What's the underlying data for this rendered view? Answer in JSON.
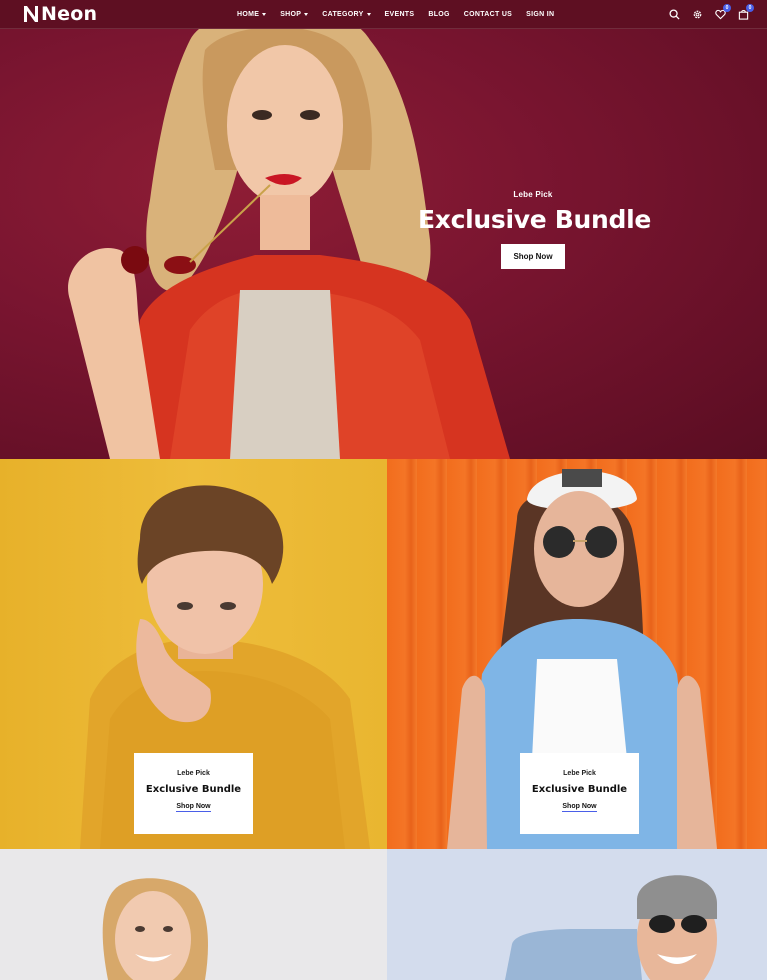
{
  "header": {
    "logo_text": "Neon",
    "nav": [
      {
        "label": "HOME",
        "caret": true
      },
      {
        "label": "SHOP",
        "caret": true
      },
      {
        "label": "CATEGORY",
        "caret": true
      },
      {
        "label": "EVENTS",
        "caret": false
      },
      {
        "label": "BLOG",
        "caret": false
      },
      {
        "label": "CONTACT US",
        "caret": false
      },
      {
        "label": "SIGN IN",
        "caret": false
      }
    ],
    "wishlist_count": "0",
    "cart_count": "0"
  },
  "hero": {
    "eyebrow": "Lebe Pick",
    "title": "Exclusive Bundle",
    "button_label": "Shop Now"
  },
  "tiles": [
    {
      "eyebrow": "Lebe Pick",
      "title": "Exclusive Bundle",
      "link_label": "Shop Now"
    },
    {
      "eyebrow": "Lebe Pick",
      "title": "Exclusive Bundle",
      "link_label": "Shop Now"
    }
  ],
  "colors": {
    "header_bg": "#5e0f22",
    "hero_bg": "#7a1530",
    "accent": "#4a5ee8",
    "tile_yellow": "#e9b630",
    "tile_orange": "#f26d1d"
  }
}
